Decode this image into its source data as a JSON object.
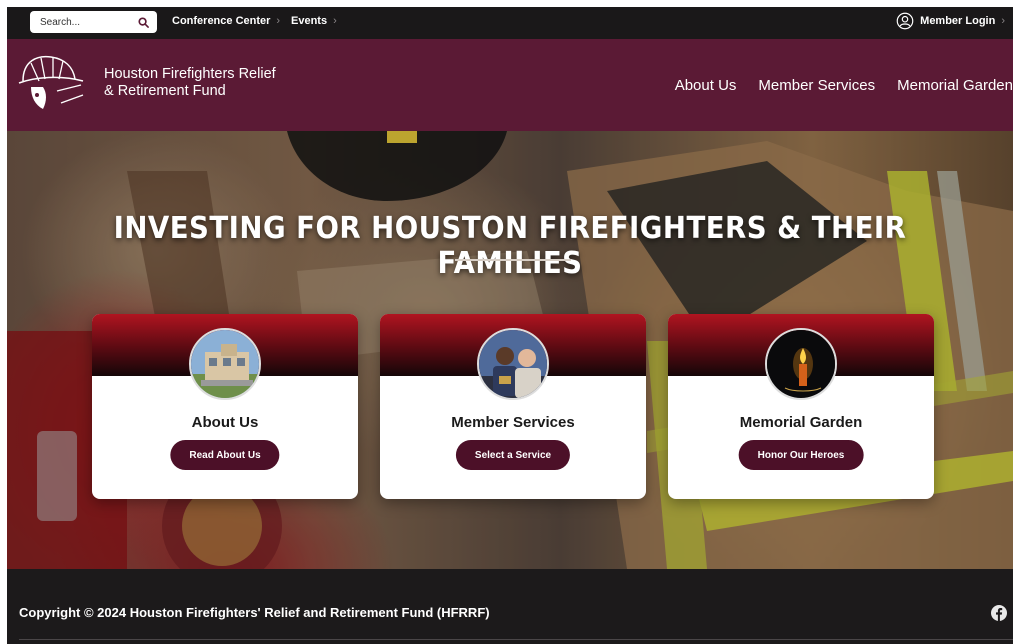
{
  "topbar": {
    "search_placeholder": "Search...",
    "links": [
      {
        "label": "Conference Center"
      },
      {
        "label": "Events"
      }
    ],
    "login_label": "Member Login"
  },
  "header": {
    "org_name_line1": "Houston Firefighters Relief",
    "org_name_line2": "& Retirement Fund",
    "nav": [
      {
        "label": "About Us"
      },
      {
        "label": "Member Services"
      },
      {
        "label": "Memorial Garden"
      }
    ]
  },
  "hero": {
    "title": "INVESTING FOR HOUSTON FIREFIGHTERS & THEIR FAMILIES"
  },
  "cards": [
    {
      "title": "About Us",
      "button": "Read About Us",
      "image": "building-photo"
    },
    {
      "title": "Member Services",
      "button": "Select a Service",
      "image": "members-photo"
    },
    {
      "title": "Memorial Garden",
      "button": "Honor Our Heroes",
      "image": "candle-photo"
    }
  ],
  "footer": {
    "copyright": "Copyright © 2024 Houston Firefighters' Relief and Retirement Fund (HFRRF)",
    "social_icon": "facebook-icon"
  },
  "colors": {
    "brand_maroon": "#5b1a35",
    "button_maroon": "#4c1028",
    "dark_bar": "#1a1819"
  }
}
